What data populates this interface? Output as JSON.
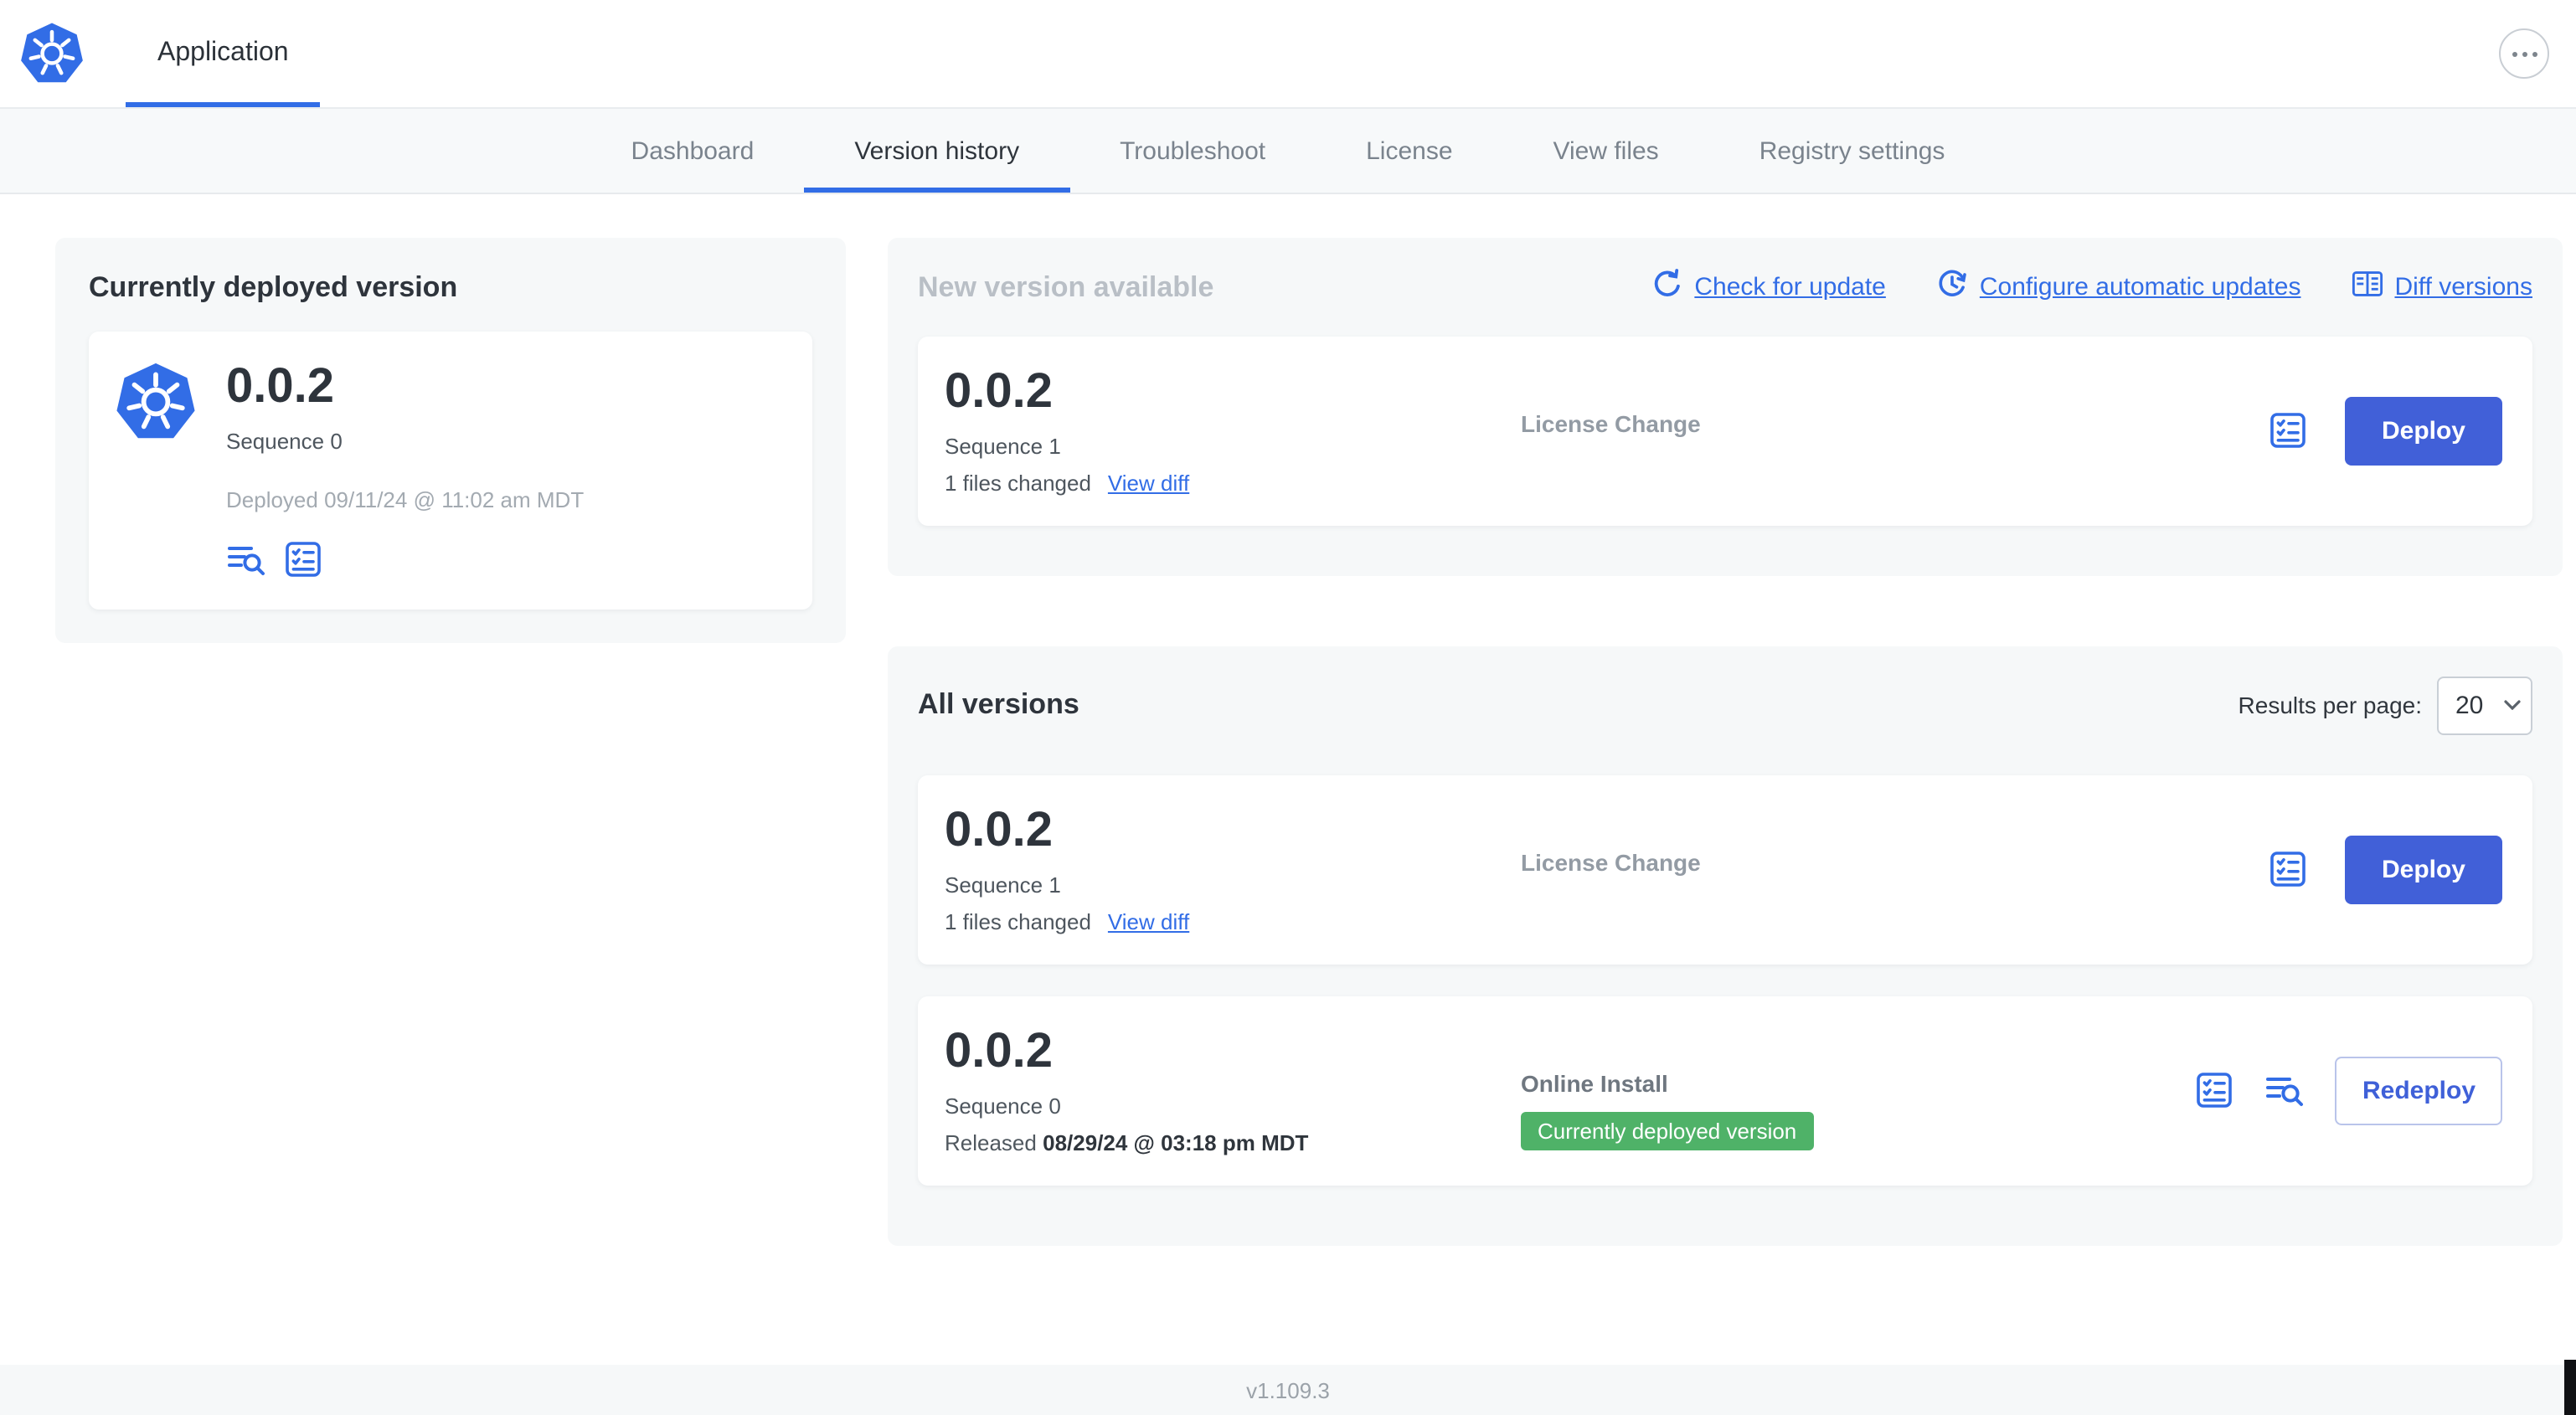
{
  "header": {
    "app_tab": "Application"
  },
  "nav": {
    "tabs": [
      {
        "label": "Dashboard",
        "active": false
      },
      {
        "label": "Version history",
        "active": true
      },
      {
        "label": "Troubleshoot",
        "active": false
      },
      {
        "label": "License",
        "active": false
      },
      {
        "label": "View files",
        "active": false
      },
      {
        "label": "Registry settings",
        "active": false
      }
    ]
  },
  "deployed_panel": {
    "title": "Currently deployed version",
    "version": "0.0.2",
    "sequence": "Sequence 0",
    "deployed_at": "Deployed 09/11/24 @ 11:02 am MDT",
    "icons": [
      "logs-icon",
      "release-notes-icon"
    ]
  },
  "new_version_panel": {
    "title": "New version available",
    "actions": [
      {
        "label": "Check for update",
        "icon": "refresh-icon"
      },
      {
        "label": "Configure automatic updates",
        "icon": "schedule-icon"
      },
      {
        "label": "Diff versions",
        "icon": "diff-icon"
      }
    ],
    "card": {
      "version": "0.0.2",
      "sequence": "Sequence 1",
      "files_changed": "1 files changed",
      "view_diff_label": "View diff",
      "source": "License Change",
      "deploy_label": "Deploy",
      "icons": [
        "release-notes-icon"
      ]
    }
  },
  "all_versions_panel": {
    "title": "All versions",
    "results_per_page_label": "Results per page:",
    "results_per_page_value": "20",
    "rows": [
      {
        "version": "0.0.2",
        "sequence": "Sequence 1",
        "files_changed": "1 files changed",
        "view_diff_label": "View diff",
        "source": "License Change",
        "action_label": "Deploy",
        "icons": [
          "release-notes-icon"
        ]
      },
      {
        "version": "0.0.2",
        "sequence": "Sequence 0",
        "released_prefix": "Released",
        "released_date": "08/29/24 @ 03:18 pm MDT",
        "source": "Online Install",
        "badge": "Currently deployed version",
        "action_label": "Redeploy",
        "icons": [
          "release-notes-icon",
          "logs-icon"
        ]
      }
    ]
  },
  "footer": {
    "app_version": "v1.109.3"
  },
  "colors": {
    "primary_blue": "#326de6",
    "button_blue": "#4160d8",
    "badge_green": "#4fb268",
    "panel_gray": "#f6f8f9"
  }
}
